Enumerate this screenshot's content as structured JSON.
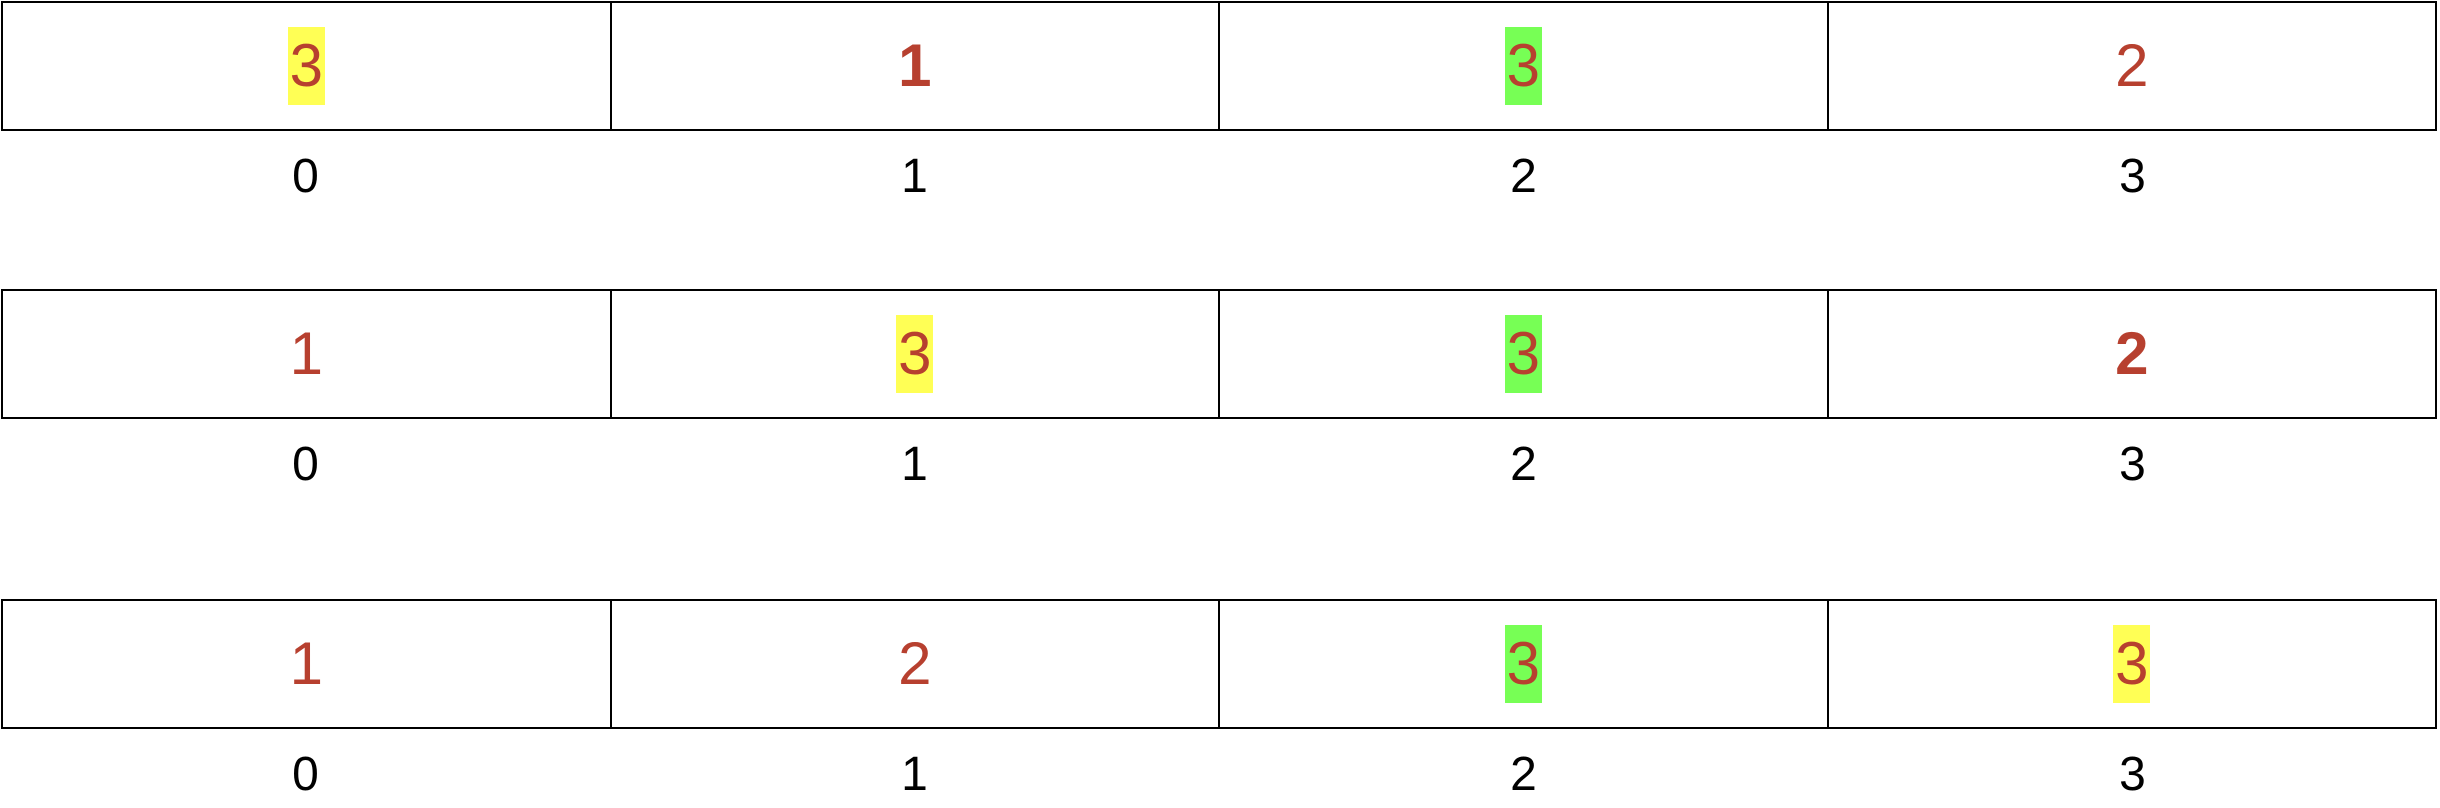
{
  "arrays": [
    {
      "cells": [
        {
          "value": "3",
          "highlight": "#ffff55",
          "bold": false
        },
        {
          "value": "1",
          "highlight": "",
          "bold": true
        },
        {
          "value": "3",
          "highlight": "#77ff55",
          "bold": false
        },
        {
          "value": "2",
          "highlight": "",
          "bold": false
        }
      ],
      "indices": [
        "0",
        "1",
        "2",
        "3"
      ]
    },
    {
      "cells": [
        {
          "value": "1",
          "highlight": "",
          "bold": false
        },
        {
          "value": "3",
          "highlight": "#ffff55",
          "bold": false
        },
        {
          "value": "3",
          "highlight": "#77ff55",
          "bold": false
        },
        {
          "value": "2",
          "highlight": "",
          "bold": true
        }
      ],
      "indices": [
        "0",
        "1",
        "2",
        "3"
      ]
    },
    {
      "cells": [
        {
          "value": "1",
          "highlight": "",
          "bold": false
        },
        {
          "value": "2",
          "highlight": "",
          "bold": false
        },
        {
          "value": "3",
          "highlight": "#77ff55",
          "bold": false
        },
        {
          "value": "3",
          "highlight": "#ffff55",
          "bold": false
        }
      ],
      "indices": [
        "0",
        "1",
        "2",
        "3"
      ]
    }
  ],
  "colors": {
    "value_text": "#b7402f",
    "index_text": "#000000",
    "border": "#000000",
    "highlight_yellow": "#ffff55",
    "highlight_green": "#77ff55"
  }
}
